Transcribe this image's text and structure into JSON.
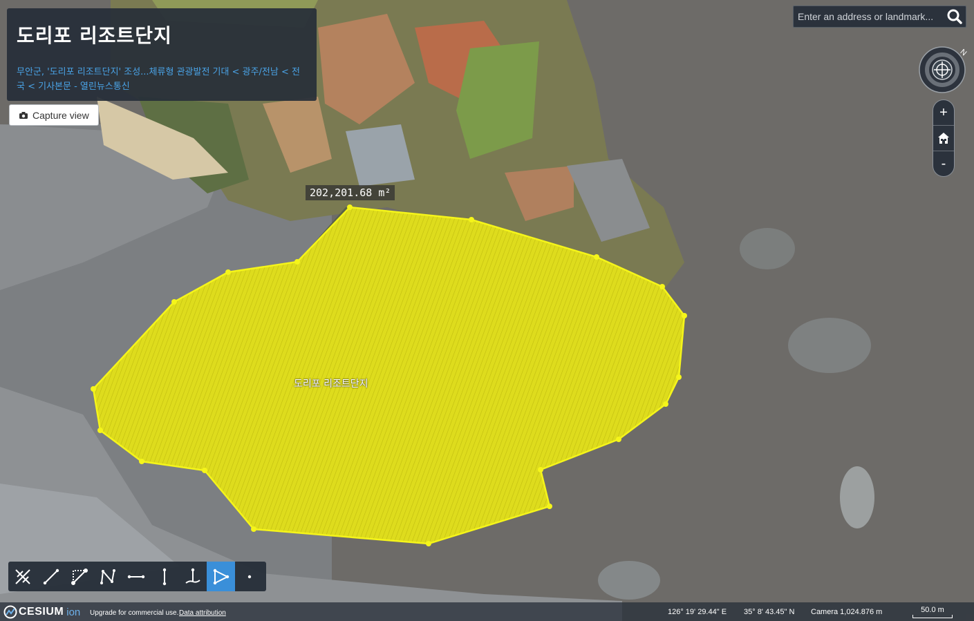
{
  "info_panel": {
    "title": "도리포 리조트단지",
    "link_text": "무안군, '도리포 리조트단지' 조성...체류형 관광발전 기대 < 광주/전남 < 전국 < 기사본문 - 열린뉴스통신"
  },
  "capture_button": {
    "label": "Capture view",
    "icon": "camera-icon"
  },
  "search": {
    "placeholder": "Enter an address or landmark...",
    "icon": "search-icon"
  },
  "compass": {
    "north_label": "N"
  },
  "zoom": {
    "in_label": "+",
    "home_icon": "home-icon",
    "out_label": "-"
  },
  "map": {
    "area_measurement": "202,201.68 m²",
    "place_label": "도리포 리조트단지",
    "polygon_color": "#f2f200"
  },
  "toolbar": {
    "tools": [
      {
        "name": "clear-tool",
        "icon": "scissors-x-icon",
        "active": false
      },
      {
        "name": "distance-tool",
        "icon": "line-icon",
        "active": false
      },
      {
        "name": "component-distance-tool",
        "icon": "triangle-line-icon",
        "active": false
      },
      {
        "name": "polyline-tool",
        "icon": "polyline-icon",
        "active": false
      },
      {
        "name": "horizontal-tool",
        "icon": "horizontal-line-icon",
        "active": false
      },
      {
        "name": "vertical-tool",
        "icon": "vertical-line-icon",
        "active": false
      },
      {
        "name": "height-tool",
        "icon": "height-icon",
        "active": false
      },
      {
        "name": "area-tool",
        "icon": "area-polygon-icon",
        "active": true
      },
      {
        "name": "point-tool",
        "icon": "point-icon",
        "active": false
      }
    ]
  },
  "bottom_bar": {
    "logo_text": "CESIUM",
    "logo_ion": "ion",
    "upgrade_text": "Upgrade for commercial use.",
    "attribution_link": "Data attribution",
    "longitude": "126° 19' 29.44\" E",
    "latitude": "35° 8' 43.45\" N",
    "camera": "Camera 1,024.876 m",
    "scale": "50.0 m"
  },
  "colors": {
    "panel": "#262e38",
    "accent": "#3a8fd9",
    "link": "#4aa3e6"
  }
}
